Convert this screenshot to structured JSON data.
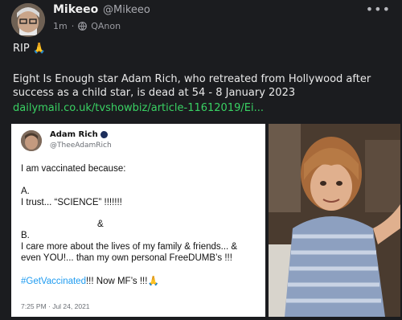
{
  "post": {
    "author_name": "Mikeeo",
    "author_handle": "@Mikeeo",
    "age": "1m",
    "separator": "·",
    "community": "QAnon",
    "line1": "RIP 🙏",
    "line2": "Eight Is Enough star Adam Rich, who retreated from Hollywood after success as a child star, is dead at 54 - 8 January 2023",
    "link_text": "dailymail.co.uk/tvshowbiz/article-11612019/Ei..."
  },
  "embedded_tweet": {
    "name": "Adam Rich",
    "handle": "@TheeAdamRich",
    "line1": "I am vaccinated because:",
    "line2": "A.",
    "line3": "I trust... “SCIENCE” !!!!!!!",
    "line4": "&",
    "line5": "B.",
    "line6": "I care more about the lives of my family & friends... &",
    "line7": "even YOU!... than my own personal FreeDUMB’s !!!",
    "hashtag": "#GetVaccinated",
    "line8_rest": "!!! Now MF’s !!!🙏",
    "timestamp": "7:25 PM · Jul 24, 2021"
  }
}
